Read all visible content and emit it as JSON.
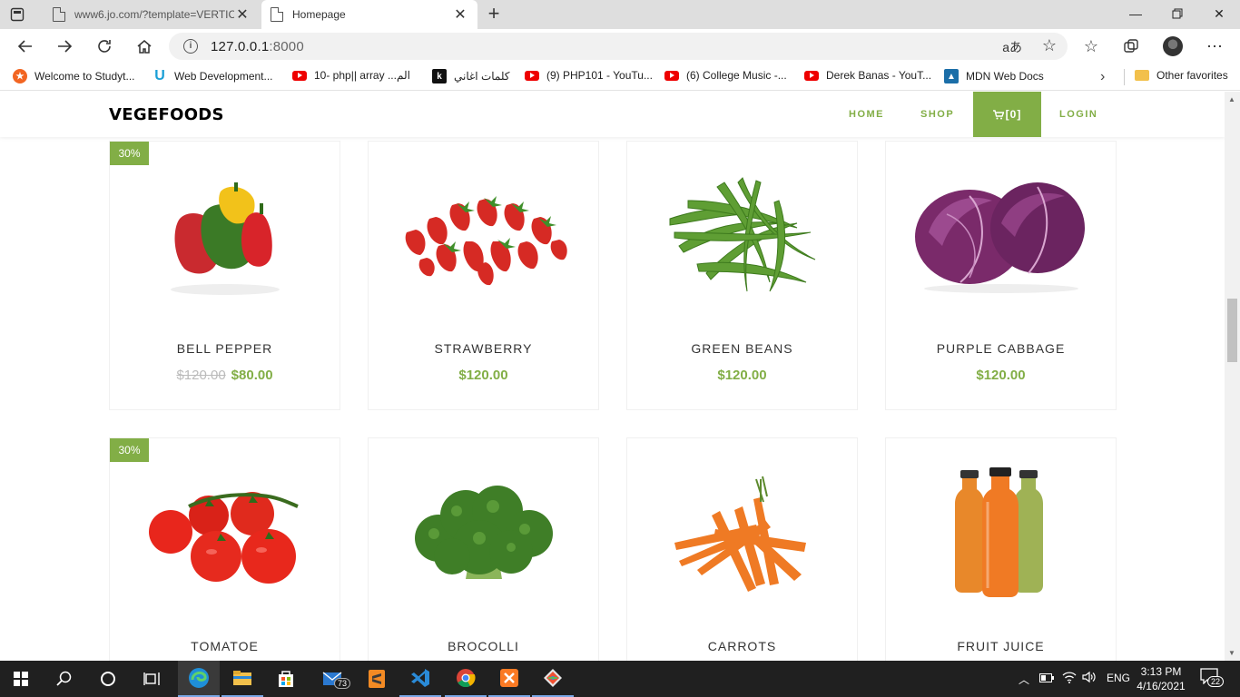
{
  "browser": {
    "tabs": [
      {
        "title": "www6.jo.com/?template=VERTIC",
        "active": false
      },
      {
        "title": "Homepage",
        "active": true
      }
    ],
    "address": {
      "host": "127.0.0.1",
      "port": ":8000"
    },
    "bookmarks": [
      {
        "label": "Welcome to Studyt...",
        "icon": "studytonight-icon"
      },
      {
        "label": "Web Development...",
        "icon": "udemy-icon"
      },
      {
        "label": "10- php|| array ...الم",
        "icon": "youtube-icon"
      },
      {
        "label": "كلمات اغاني",
        "icon": "k-icon"
      },
      {
        "label": "(9) PHP101 - YouTu...",
        "icon": "youtube-icon"
      },
      {
        "label": "(6) College Music -...",
        "icon": "youtube-icon"
      },
      {
        "label": "Derek Banas - YouT...",
        "icon": "youtube-icon"
      },
      {
        "label": "MDN Web Docs",
        "icon": "mdn-icon"
      }
    ],
    "other_favorites": "Other favorites"
  },
  "site": {
    "brand": "VEGEFOODS",
    "nav": {
      "home": "HOME",
      "shop": "SHOP",
      "cart": "[0]",
      "login": "LOGIN"
    },
    "accent_color": "#82ae46"
  },
  "products": [
    {
      "name": "BELL PEPPER",
      "badge": "30%",
      "old_price": "$120.00",
      "price": "$80.00"
    },
    {
      "name": "STRAWBERRY",
      "badge": "",
      "old_price": "",
      "price": "$120.00"
    },
    {
      "name": "GREEN BEANS",
      "badge": "",
      "old_price": "",
      "price": "$120.00"
    },
    {
      "name": "PURPLE CABBAGE",
      "badge": "",
      "old_price": "",
      "price": "$120.00"
    },
    {
      "name": "TOMATOE",
      "badge": "30%",
      "old_price": "",
      "price": ""
    },
    {
      "name": "BROCOLLI",
      "badge": "",
      "old_price": "",
      "price": ""
    },
    {
      "name": "CARROTS",
      "badge": "",
      "old_price": "",
      "price": ""
    },
    {
      "name": "FRUIT JUICE",
      "badge": "",
      "old_price": "",
      "price": ""
    }
  ],
  "taskbar": {
    "mail_badge": "73",
    "language": "ENG",
    "time": "3:13 PM",
    "date": "4/16/2021",
    "notifications": "22"
  }
}
